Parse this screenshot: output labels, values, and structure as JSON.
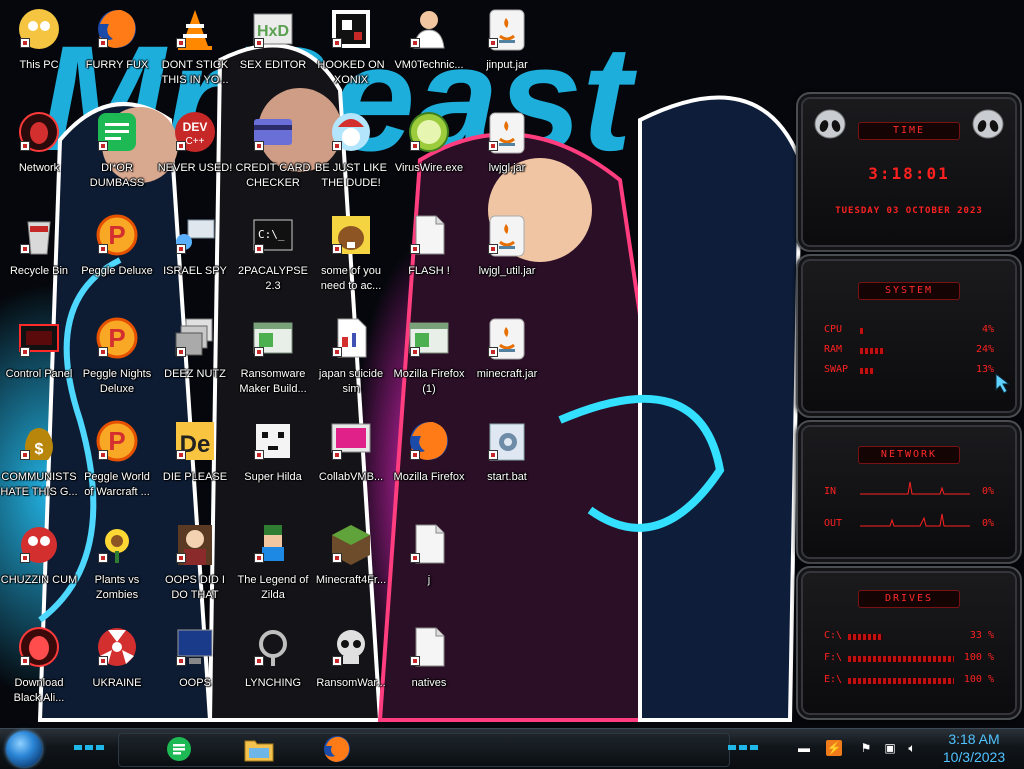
{
  "desktop": {
    "wallpaper_text": "MrBeast",
    "columns": [
      [
        {
          "label": "This PC",
          "icon": "this-pc-icon"
        },
        {
          "label": "Network",
          "icon": "network-icon"
        },
        {
          "label": "Recycle Bin",
          "icon": "recycle-bin-icon"
        },
        {
          "label": "Control Panel",
          "icon": "control-panel-icon"
        },
        {
          "label": "COMMUNISTS HATE THIS G...",
          "icon": "money-bag-icon"
        },
        {
          "label": "CHUZZIN CUM",
          "icon": "chuzzle-icon"
        },
        {
          "label": "Download Black Ali...",
          "icon": "alien-icon"
        }
      ],
      [
        {
          "label": "FURRY FUX",
          "icon": "firefox-icon"
        },
        {
          "label": "DI*OR DUMBASS",
          "icon": "green-chat-icon"
        },
        {
          "label": "Peggle Deluxe",
          "icon": "peggle-icon"
        },
        {
          "label": "Peggle Nights Deluxe",
          "icon": "peggle-icon"
        },
        {
          "label": "Peggle World of Warcraft ...",
          "icon": "peggle-icon"
        },
        {
          "label": "Plants vs Zombies",
          "icon": "flower-icon"
        },
        {
          "label": "UKRAINE",
          "icon": "radiation-icon"
        }
      ],
      [
        {
          "label": "DONT STICK THIS IN YO...",
          "icon": "vlc-cone-icon"
        },
        {
          "label": "NEVER USED!",
          "icon": "dev-icon"
        },
        {
          "label": "ISRAEL SPY",
          "icon": "network-computer-icon"
        },
        {
          "label": "DEEZ NUTZ",
          "icon": "windows-stack-icon"
        },
        {
          "label": "DIE PLEASE",
          "icon": "de-icon"
        },
        {
          "label": "OOPS DID I DO THAT",
          "icon": "portrait-icon"
        },
        {
          "label": "OOPS",
          "icon": "blue-monitor-icon"
        }
      ],
      [
        {
          "label": "SEX EDITOR",
          "icon": "hxd-icon"
        },
        {
          "label": "CREDIT CARD CHECKER",
          "icon": "credit-card-icon"
        },
        {
          "label": "2PACALYPSE 2.3",
          "icon": "console-icon"
        },
        {
          "label": "Ransomware Maker Build...",
          "icon": "app-window-icon"
        },
        {
          "label": "Super Hilda",
          "icon": "pixel-cat-icon"
        },
        {
          "label": "The Legend of Zilda",
          "icon": "pixel-hero-icon"
        },
        {
          "label": "LYNCHING",
          "icon": "rope-icon"
        }
      ],
      [
        {
          "label": "HOOKED ON XONIX",
          "icon": "xonix-icon"
        },
        {
          "label": "BE JUST LIKE THE DUDE!",
          "icon": "santa-icon"
        },
        {
          "label": "some of you need to ac...",
          "icon": "beaver-icon"
        },
        {
          "label": "japan suicide sim",
          "icon": "document-icon"
        },
        {
          "label": "CollabVMB...",
          "icon": "pink-monitor-icon"
        },
        {
          "label": "Minecraft4Fr...",
          "icon": "grass-block-icon"
        },
        {
          "label": "RansomWar...",
          "icon": "skull-icon"
        }
      ],
      [
        {
          "label": "VM0Technic...",
          "icon": "doctor-icon"
        },
        {
          "label": "VirusWire.exe",
          "icon": "lime-icon"
        },
        {
          "label": "FLASH !",
          "icon": "file-icon"
        },
        {
          "label": "Mozilla Firefox (1)",
          "icon": "app-window-icon"
        },
        {
          "label": "Mozilla Firefox",
          "icon": "firefox-icon"
        },
        {
          "label": "j",
          "icon": "file-icon"
        },
        {
          "label": "natives",
          "icon": "file-icon"
        }
      ],
      [
        {
          "label": "jinput.jar",
          "icon": "java-icon"
        },
        {
          "label": "lwjgl.jar",
          "icon": "java-icon"
        },
        {
          "label": "lwjgl_util.jar",
          "icon": "java-icon"
        },
        {
          "label": "minecraft.jar",
          "icon": "java-icon"
        },
        {
          "label": "start.bat",
          "icon": "gear-file-icon"
        }
      ]
    ]
  },
  "gadgets": {
    "time": {
      "title": "TIME",
      "clock": "3:18:01",
      "date": "TUESDAY 03 OCTOBER 2023"
    },
    "system": {
      "title": "SYSTEM",
      "cpu_label": "CPU",
      "cpu": "4%",
      "cpu_fraction": 0.04,
      "ram_label": "RAM",
      "ram": "24%",
      "ram_fraction": 0.24,
      "swap_label": "SWAP",
      "swap": "13%",
      "swap_fraction": 0.13
    },
    "network": {
      "title": "NETWORK",
      "in_label": "IN",
      "in": "0%",
      "out_label": "OUT",
      "out": "0%"
    },
    "drives": {
      "title": "DRIVES",
      "d1_label": "C:\\",
      "d1": "33 %",
      "d1_fraction": 0.33,
      "d2_label": "F:\\",
      "d2": "100 %",
      "d2_fraction": 1.0,
      "d3_label": "E:\\",
      "d3": "100 %",
      "d3_fraction": 1.0
    }
  },
  "taskbar": {
    "pinned": [
      {
        "name": "green-chat-app",
        "icon": "green-chat-icon"
      },
      {
        "name": "file-explorer",
        "icon": "folder-icon"
      },
      {
        "name": "firefox",
        "icon": "firefox-icon"
      }
    ],
    "clock_time": "3:18 AM",
    "clock_date": "10/3/2023"
  },
  "colors": {
    "accent_cyan": "#1fb7e8",
    "gadget_red": "#ff2020",
    "clock_blue": "#4fc3ff"
  }
}
